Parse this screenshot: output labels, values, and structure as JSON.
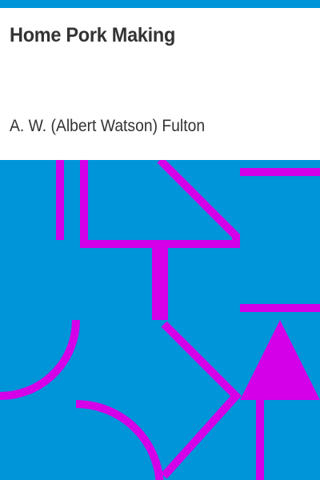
{
  "book": {
    "title": "Home Pork Making",
    "author": "A. W. (Albert Watson) Fulton"
  },
  "colors": {
    "accent_bar": "#0095d8",
    "art_background": "#0095d8",
    "art_lines": "#d400e8",
    "text": "#333333",
    "page_background": "#ffffff"
  }
}
